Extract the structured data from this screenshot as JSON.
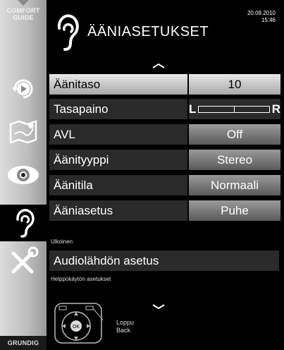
{
  "sidebar": {
    "comfort_guide": "COMFORT\nGUIDE",
    "brand": "GRUNDIG",
    "icons": [
      "playback-icon",
      "map-icon",
      "eye-icon",
      "ear-icon",
      "tools-icon"
    ]
  },
  "header": {
    "title": "ÄÄNIASETUKSET",
    "date": "20.09.2010",
    "time": "15:46"
  },
  "menu": {
    "items": [
      {
        "label": "Äänitaso",
        "value": "10"
      },
      {
        "label": "Tasapaino",
        "balance_left": "L",
        "balance_right": "R",
        "balance_level": 0.5
      },
      {
        "label": "AVL",
        "value": "Off"
      },
      {
        "label": "Äänityyppi",
        "value": "Stereo"
      },
      {
        "label": "Äänitila",
        "value": "Normaali"
      },
      {
        "label": "Ääniasetus",
        "value": "Puhe"
      }
    ]
  },
  "sections": {
    "outside": "Ulkoinen",
    "audio_output": "Audiolähdön asetus",
    "accessibility": "Helppokäytön asetukset"
  },
  "remote_legend": {
    "end": "Loppu",
    "back": "Back",
    "ok": "OK"
  }
}
